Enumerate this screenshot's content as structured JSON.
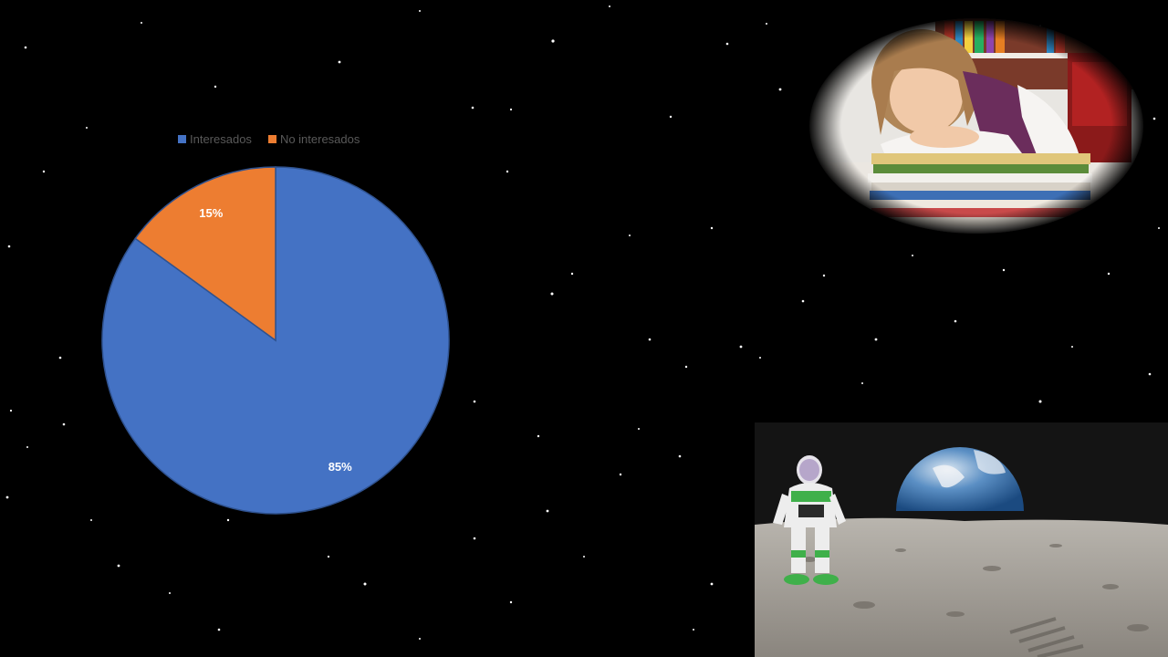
{
  "chart_data": {
    "type": "pie",
    "title": "",
    "categories": [
      "Interesados",
      "No interesados"
    ],
    "values": [
      85,
      15
    ],
    "data_labels": [
      "85%",
      "15%"
    ],
    "colors": [
      "#4472C4",
      "#ED7D31"
    ],
    "legend_position": "top",
    "start_angle": "12 o'clock",
    "direction": "clockwise"
  },
  "images": {
    "student": "girl-asleep-on-books-photo",
    "moon": "toy-astronaut-on-moon-with-earth-photo"
  }
}
